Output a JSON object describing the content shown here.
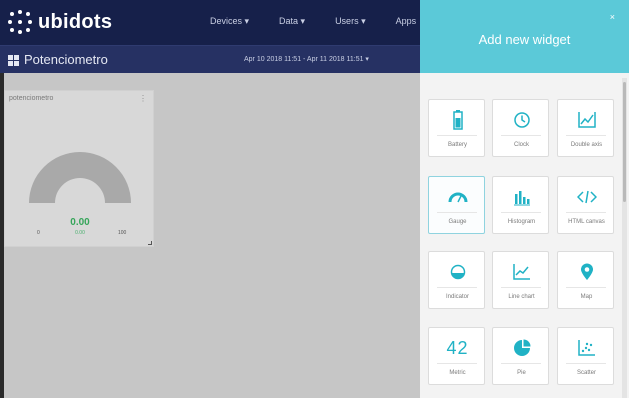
{
  "app": {
    "brand": "ubidots"
  },
  "nav": {
    "items": [
      "Devices ▾",
      "Data ▾",
      "Users ▾",
      "Apps"
    ]
  },
  "dashboard": {
    "title": "Potenciometro",
    "date_range": "Apr 10 2018 11:51 - Apr 11 2018 11:51 ▾"
  },
  "widget": {
    "title": "potenciometro",
    "menu": "⋮",
    "value": "0.00",
    "sub": "0.00",
    "min": "0",
    "max": "100",
    "level": 0.0
  },
  "panel": {
    "title": "Add new widget",
    "close": "×",
    "tiles": [
      {
        "label": "Battery",
        "icon": "battery-icon"
      },
      {
        "label": "Clock",
        "icon": "clock-icon"
      },
      {
        "label": "Double axis",
        "icon": "double-axis-icon"
      },
      {
        "label": "Gauge",
        "icon": "gauge-icon"
      },
      {
        "label": "Histogram",
        "icon": "histogram-icon"
      },
      {
        "label": "HTML canvas",
        "icon": "code-icon"
      },
      {
        "label": "Indicator",
        "icon": "indicator-icon"
      },
      {
        "label": "Line chart",
        "icon": "line-chart-icon"
      },
      {
        "label": "Map",
        "icon": "map-pin-icon"
      },
      {
        "label": "Metric",
        "icon": "metric-icon",
        "text": "42"
      },
      {
        "label": "Pie",
        "icon": "pie-icon"
      },
      {
        "label": "Scatter",
        "icon": "scatter-icon"
      }
    ]
  },
  "colors": {
    "navbar": "#16204a",
    "subbar": "#263163",
    "panel_header": "#5bc9d8",
    "icon_accent": "#20b2c5",
    "gauge_value": "#36a55a"
  }
}
